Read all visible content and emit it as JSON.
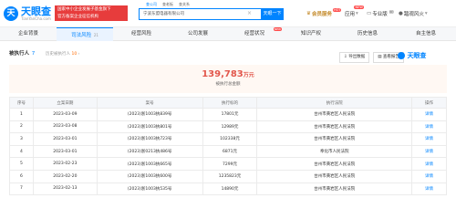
{
  "header": {
    "logo_mark": "天",
    "logo_name": "天眼查",
    "logo_url": "TianYanCha.com",
    "badge_line1": "国家中小企业发展子基金旗下",
    "badge_line2": "官方备案企业征信机构",
    "search_tabs": [
      "查公司",
      "查老板",
      "查关系"
    ],
    "search_value": "宁波东盟电器有限公司",
    "search_button": "天眼一下",
    "nav": {
      "vip": "会员服务",
      "hot": "HOT",
      "app": "应用",
      "app_new": "NEW",
      "pro": "专业版",
      "user": "踏观风火"
    }
  },
  "tabs": [
    {
      "label": "企业背景",
      "num": "",
      "active": false,
      "new": false
    },
    {
      "label": "司法风险",
      "num": "21",
      "active": true,
      "new": false
    },
    {
      "label": "经营风险",
      "num": "",
      "active": false,
      "new": false
    },
    {
      "label": "公司发展",
      "num": "",
      "active": false,
      "new": false
    },
    {
      "label": "经营状况",
      "num": "",
      "active": false,
      "new": true
    },
    {
      "label": "知识产权",
      "num": "",
      "active": false,
      "new": false
    },
    {
      "label": "历史信息",
      "num": "",
      "active": false,
      "new": false
    },
    {
      "label": "自主信息",
      "num": "",
      "active": false,
      "new": false
    }
  ],
  "section": {
    "title": "被执行人",
    "count": "7",
    "history_label": "历史被执行人",
    "history_count": "10",
    "btn_download": "导出数据",
    "btn_report": "查看报告",
    "brand": "天眼查"
  },
  "summary": {
    "amount": "139,783",
    "unit": "万元",
    "label": "被执行总金额"
  },
  "table": {
    "headers": [
      "序号",
      "立案日期",
      "案号",
      "执行标的",
      "执行法院",
      "操作"
    ],
    "rows": [
      {
        "idx": "1",
        "date": "2023-03-09",
        "case": "(2023)浙1003执839号",
        "amount": "17801元",
        "court": "台州市黄岩区人民法院",
        "op": "详情"
      },
      {
        "idx": "2",
        "date": "2023-03-08",
        "case": "(2023)浙1003执801号",
        "amount": "12989元",
        "court": "台州市黄岩区人民法院",
        "op": "详情"
      },
      {
        "idx": "3",
        "date": "2023-03-01",
        "case": "(2023)浙1003执723号",
        "amount": "102338元",
        "court": "台州市黄岩区人民法院",
        "op": "详情"
      },
      {
        "idx": "4",
        "date": "2023-03-01",
        "case": "(2023)浙0213执486号",
        "amount": "6871元",
        "court": "奉化市人民法院",
        "op": "详情"
      },
      {
        "idx": "5",
        "date": "2023-02-23",
        "case": "(2023)浙1003执665号",
        "amount": "7299元",
        "court": "台州市黄岩区人民法院",
        "op": "详情"
      },
      {
        "idx": "6",
        "date": "2023-02-20",
        "case": "(2023)浙1003执600号",
        "amount": "1235823元",
        "court": "台州市黄岩区人民法院",
        "op": "详情"
      },
      {
        "idx": "7",
        "date": "2023-02-13",
        "case": "(2023)浙1003执535号",
        "amount": "14890元",
        "court": "台州市黄岩区人民法院",
        "op": "详情"
      }
    ]
  },
  "colors": {
    "accent": "#0084ff",
    "amount": "#e2574c",
    "badge": "#e73c3c"
  }
}
